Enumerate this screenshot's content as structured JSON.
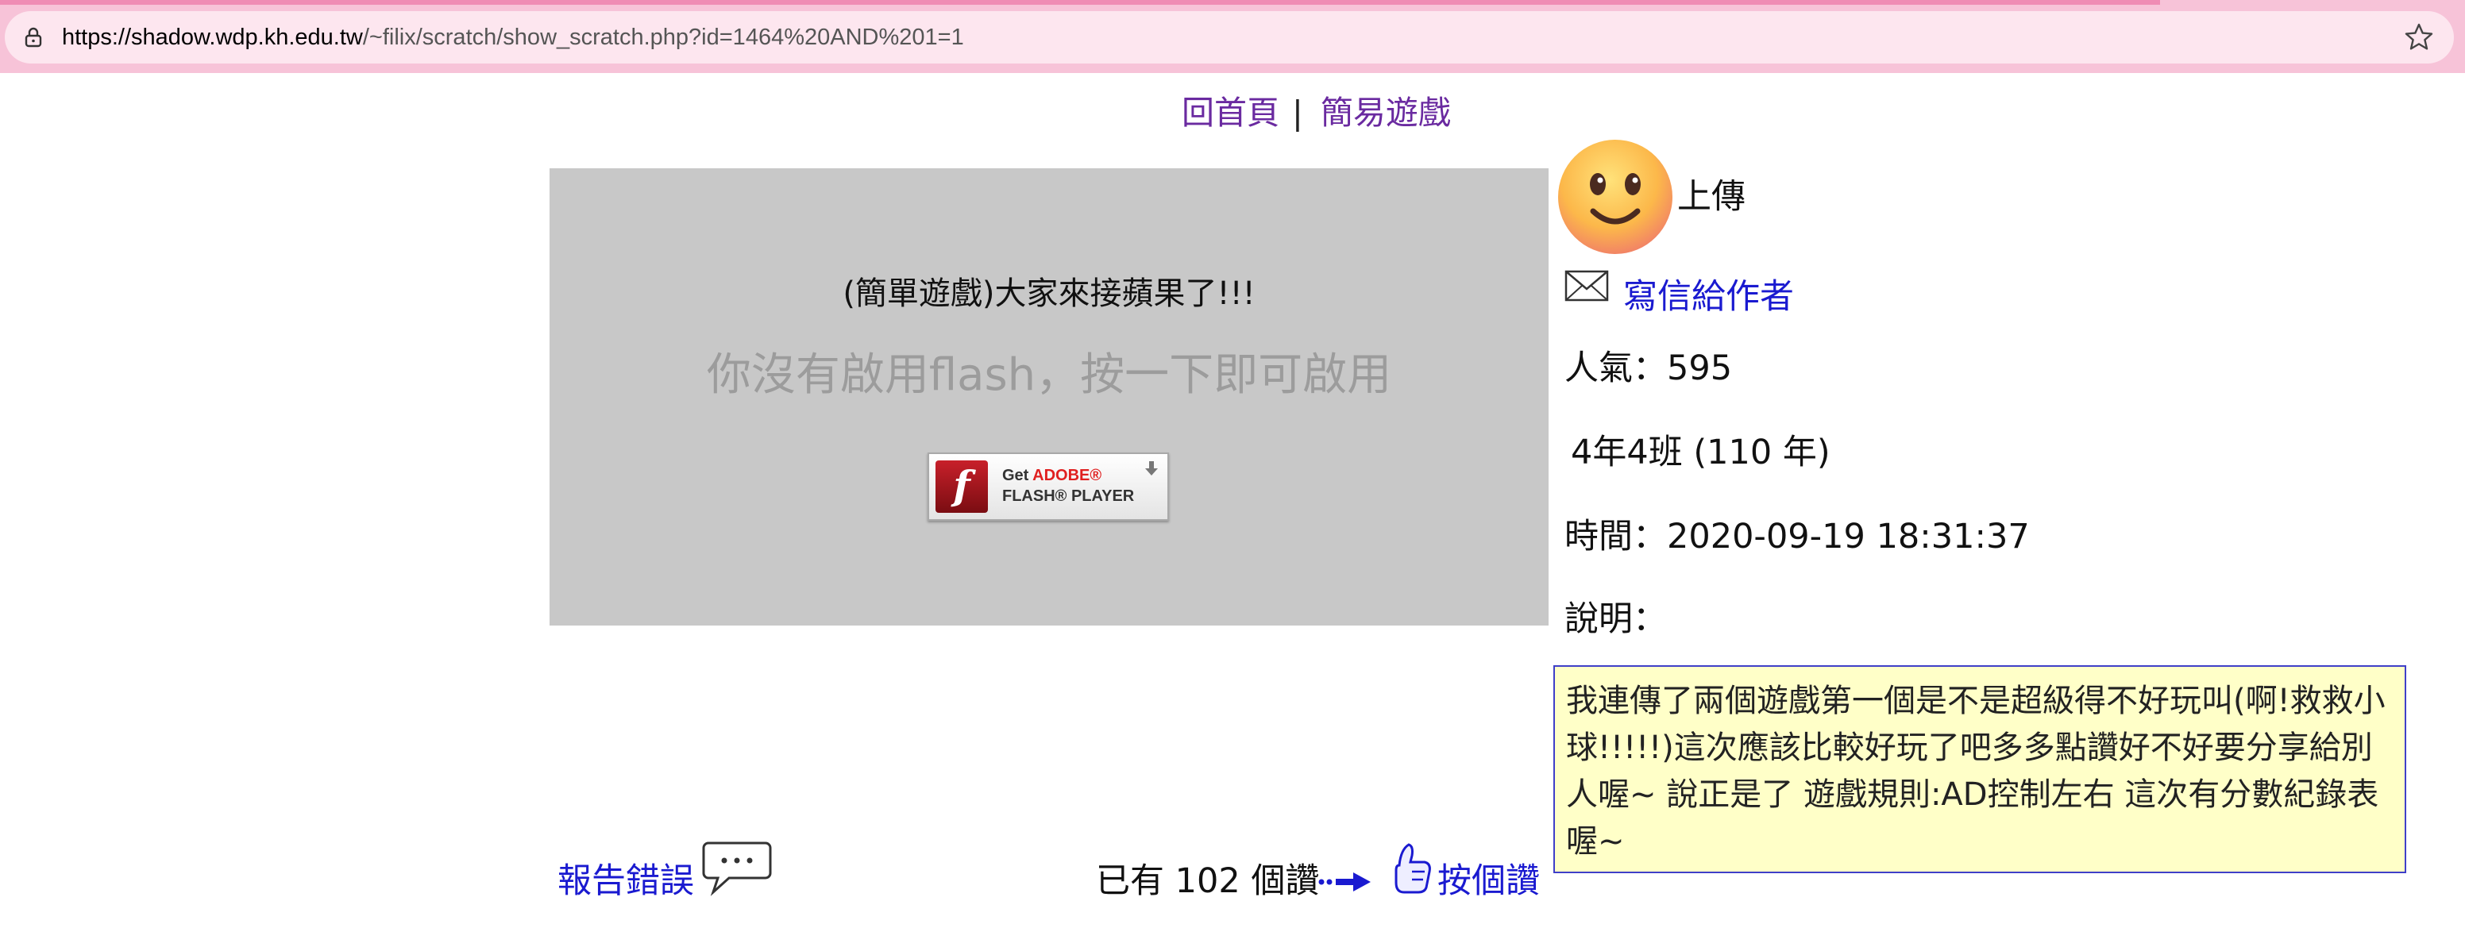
{
  "browser": {
    "url_host": "https://shadow.wdp.kh.edu.tw",
    "url_path": "/~filix/scratch/show_scratch.php?id=1464%20AND%201=1"
  },
  "nav": {
    "home": "回首頁",
    "separator": "|",
    "simple_games": "簡易遊戲"
  },
  "flash": {
    "title": "(簡單遊戲)大家來接蘋果了!!!",
    "hint": "你沒有啟用flash，按一下即可啟用",
    "button_line1_a": "Get ",
    "button_line1_b": "ADOBE®",
    "button_line2": "FLASH® PLAYER"
  },
  "author": {
    "upload_label": "上傳",
    "mail_label": "寫信給作者"
  },
  "info": {
    "popularity": "人氣：595",
    "class": "4年4班 (110 年)",
    "time": "時間：2020-09-19 18:31:37",
    "desc_label": "說明："
  },
  "description": "我連傳了兩個遊戲第一個是不是超級得不好玩叫(啊!救救小球!!!!!)這次應該比較好玩了吧多多點讚好不好要分享給別人喔~ 說正是了 遊戲規則:AD控制左右 這次有分數紀錄表喔~",
  "footer": {
    "report": "報告錯誤",
    "likes": "已有 102 個讚",
    "like_button": "按個讚"
  },
  "colors": {
    "topbar": "#f7c3d8",
    "link": "#1a1ad0",
    "nav_link": "#6a2aa0",
    "desc_bg": "#ffffc8",
    "desc_border": "#3f3fc8",
    "flash_bg": "#c8c8c8"
  },
  "icons": [
    "lock-icon",
    "star-icon",
    "flash-logo-icon",
    "download-icon",
    "smiley-avatar-icon",
    "mail-icon",
    "chat-bubble-icon",
    "arrow-right-icon",
    "thumbs-up-icon"
  ]
}
